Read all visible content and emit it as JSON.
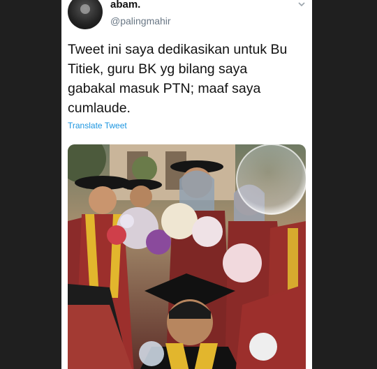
{
  "tweet": {
    "display_name": "abam.",
    "handle": "@palingmahir",
    "text": "Tweet ini saya dedikasikan untuk Bu Titiek, guru BK yg bilang saya gabakal masuk PTN; maaf saya cumlaude.",
    "translate_label": "Translate Tweet"
  },
  "icons": {
    "menu": "chevron-down-icon"
  },
  "colors": {
    "link": "#1b95e0",
    "handle": "#687684",
    "background": "#ffffff"
  }
}
